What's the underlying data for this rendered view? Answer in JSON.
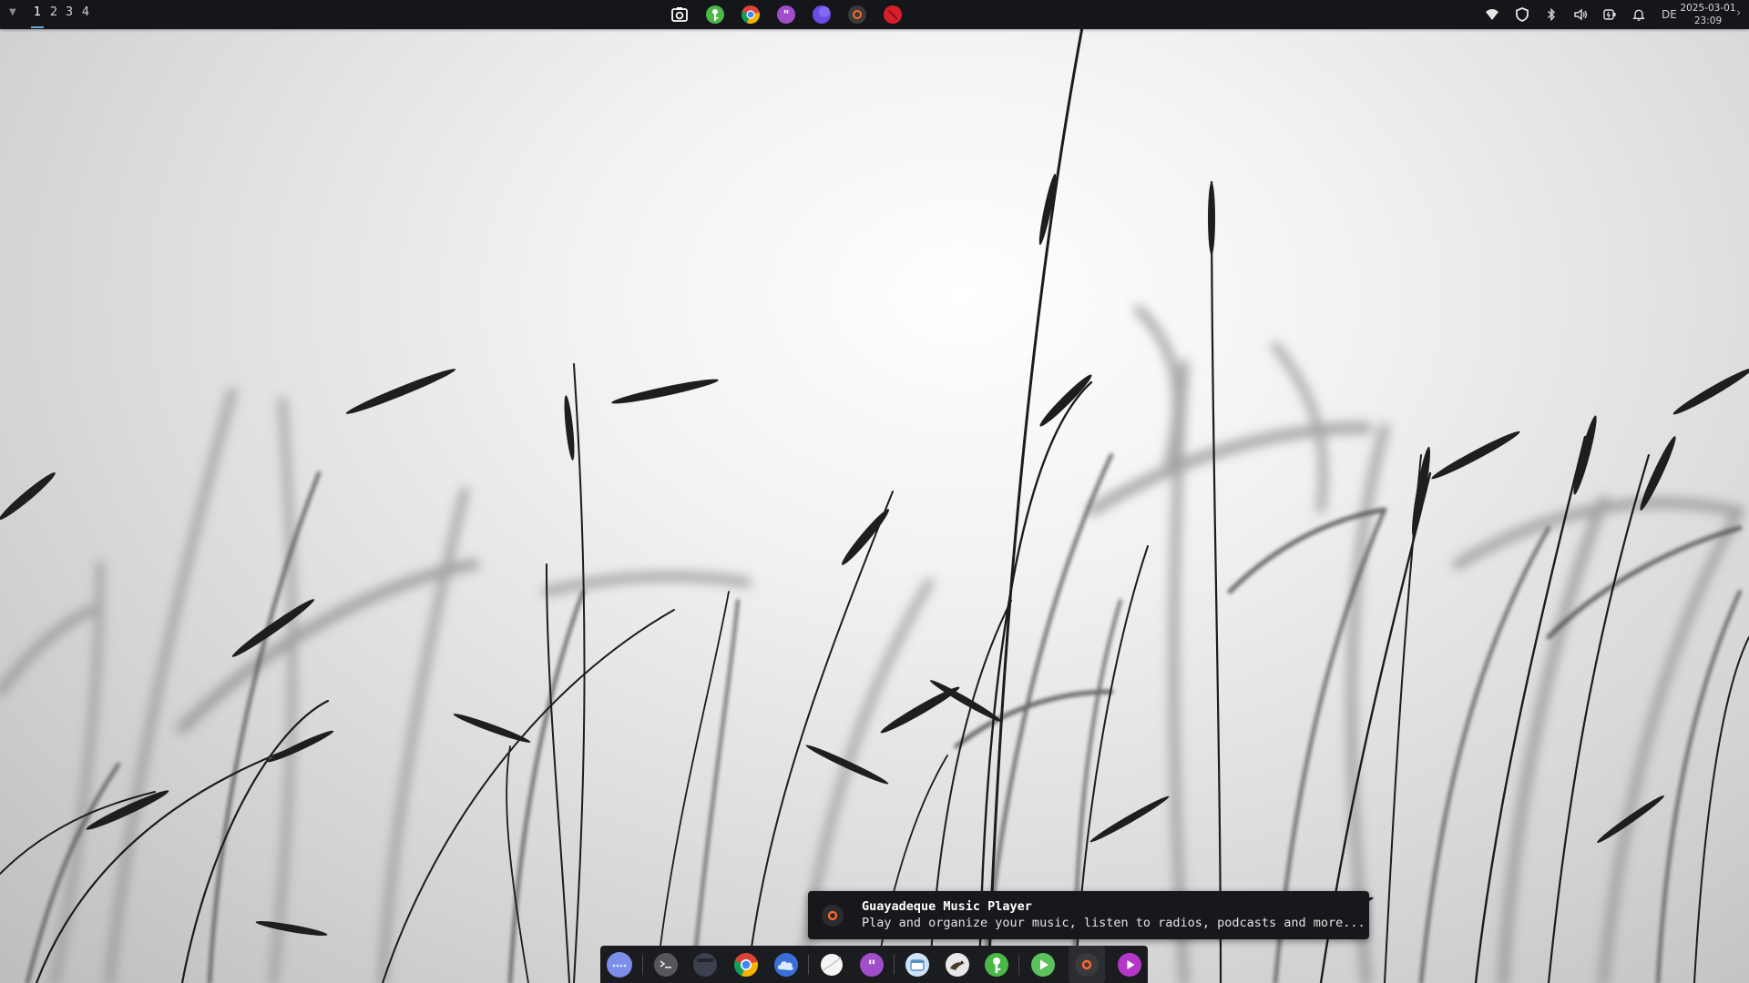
{
  "top_panel": {
    "workspace_menu_glyph": "▼",
    "workspaces": [
      {
        "label": "1",
        "active": true
      },
      {
        "label": "2",
        "active": false
      },
      {
        "label": "3",
        "active": false
      },
      {
        "label": "4",
        "active": false
      }
    ],
    "pinned_apps": [
      {
        "name": "screenshot-tool",
        "icon": "camera-icon"
      },
      {
        "name": "keepassxc",
        "icon": "keepassxc-icon"
      },
      {
        "name": "google-chrome",
        "icon": "chrome-icon"
      },
      {
        "name": "quote-app",
        "icon": "quote-icon"
      },
      {
        "name": "moon-app",
        "icon": "moon-icon"
      },
      {
        "name": "guayadeque",
        "icon": "guayadeque-icon"
      },
      {
        "name": "red-app",
        "icon": "red-circle-icon"
      }
    ],
    "tray": [
      "wifi-icon",
      "shield-icon",
      "bluetooth-icon",
      "volume-icon",
      "battery-icon",
      "bell-icon"
    ],
    "keyboard_layout": "DE",
    "clock_date": "2025-03-01",
    "clock_time": "23:09",
    "overflow_glyph": "›"
  },
  "notification": {
    "icon": "guayadeque-icon",
    "title": "Guayadeque Music Player",
    "body": "Play and organize your music, listen to radios, podcasts and more..."
  },
  "dock": {
    "items": [
      {
        "name": "app-grid",
        "icon": "dots-icon"
      },
      {
        "name": "terminal",
        "icon": "terminal-icon"
      },
      {
        "name": "window-app",
        "icon": "window-icon"
      },
      {
        "name": "google-chrome",
        "icon": "chrome-icon"
      },
      {
        "name": "cloud-app",
        "icon": "cloud-icon"
      },
      {
        "name": "white-app",
        "icon": "white-circle-icon"
      },
      {
        "name": "quote-app",
        "icon": "quote-icon"
      },
      {
        "name": "notes-app",
        "icon": "notes-icon"
      },
      {
        "name": "bird-app",
        "icon": "bird-icon"
      },
      {
        "name": "keepassxc",
        "icon": "keepassxc-icon"
      },
      {
        "name": "play-app",
        "icon": "play-icon"
      },
      {
        "name": "guayadeque",
        "icon": "guayadeque-icon",
        "running": true
      },
      {
        "name": "media-player",
        "icon": "media-play-icon"
      }
    ]
  },
  "colors": {
    "panel_bg": "#151619",
    "dock_bg": "#1b1c20",
    "accent": "#5fb0d8"
  }
}
